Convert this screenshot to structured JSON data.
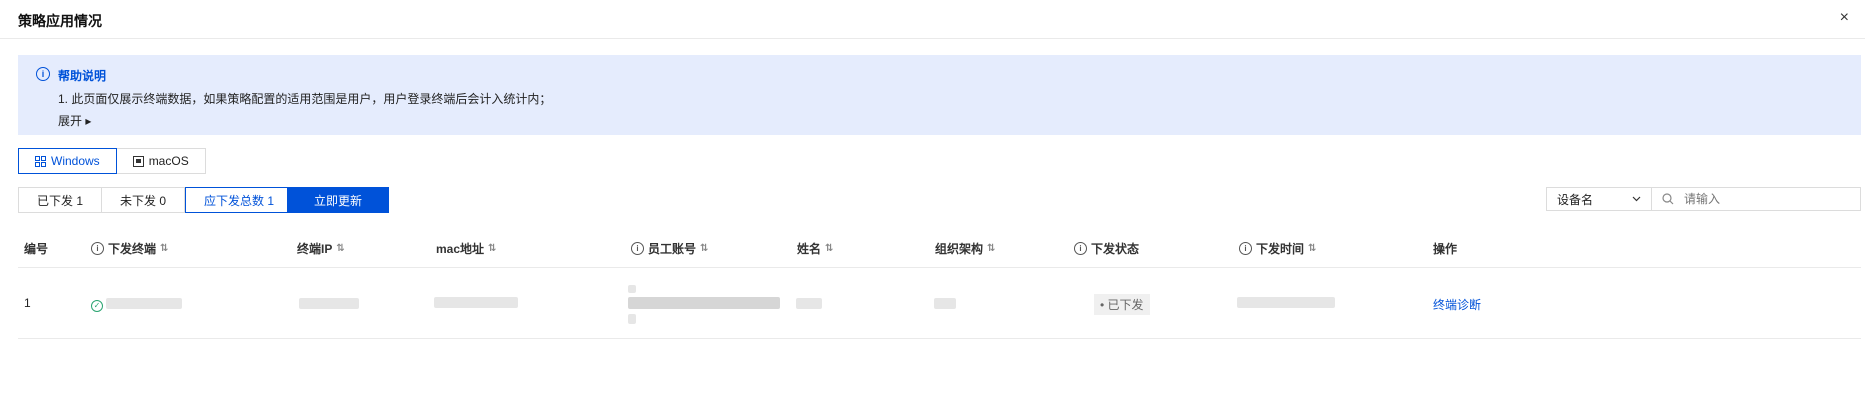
{
  "dialog": {
    "title": "策略应用情况",
    "close": "×"
  },
  "help": {
    "title": "帮助说明",
    "line1": "1. 此页面仅展示终端数据，如果策略配置的适用范围是用户，用户登录终端后会计入统计内；",
    "expand": "展开 ▸"
  },
  "os_tabs": [
    {
      "label": "Windows",
      "icon": "windows-icon"
    },
    {
      "label": "macOS",
      "icon": "monitor-icon"
    }
  ],
  "filters": {
    "issued": "已下发 1",
    "not_issued": "未下发 0",
    "total": "应下发总数 1",
    "update_button": "立即更新"
  },
  "search": {
    "field_select": "设备名",
    "placeholder": "请输入"
  },
  "table": {
    "columns": [
      "编号",
      "下发终端",
      "终端IP",
      "mac地址",
      "员工账号",
      "姓名",
      "组织架构",
      "下发状态",
      "下发时间",
      "操作"
    ],
    "rows": [
      {
        "index": "1",
        "status": "• 已下发",
        "action": "终端诊断"
      }
    ]
  },
  "colors": {
    "accent": "#0052d9",
    "help_bg": "#e5ecfd",
    "success": "#2ba471"
  }
}
